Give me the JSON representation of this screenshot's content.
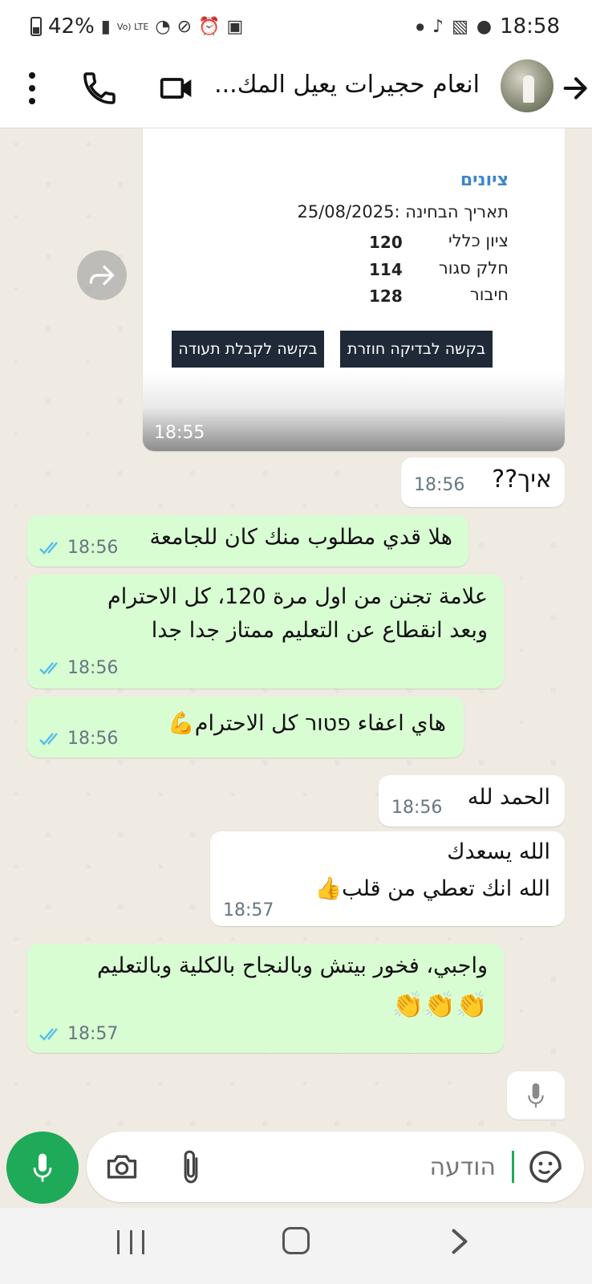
{
  "status_bar": {
    "battery": "42%",
    "time": "18:58",
    "volte_label": "Vo) LTE"
  },
  "header": {
    "contact_name": "انعام حجيرات يعيل المك...",
    "icons": [
      "back-arrow-icon",
      "avatar",
      "video-call-icon",
      "voice-call-icon",
      "more-options-icon"
    ]
  },
  "image_card": {
    "section_title": "ציונים",
    "exam_date": "תאריך הבחינה :25/08/2025",
    "rows": [
      {
        "label": "ציון כללי",
        "value": "120"
      },
      {
        "label": "חלק סגור",
        "value": "114"
      },
      {
        "label": "חיבור",
        "value": "128"
      }
    ],
    "button_recheck": "בקשה לבדיקה חוזרת",
    "button_certificate": "בקשה לקבלת תעודה",
    "time": "18:55"
  },
  "messages": [
    {
      "dir": "in",
      "lines": [
        "איך??"
      ],
      "time": "18:56"
    },
    {
      "dir": "out",
      "lines": [
        "هلا قدي مطلوب منك كان للجامعة"
      ],
      "time": "18:56"
    },
    {
      "dir": "out",
      "lines": [
        "علامة تجنن من اول مرة 120، كل الاحترام",
        "وبعد انقطاع عن التعليم ممتاز جدا جدا"
      ],
      "time": "18:56"
    },
    {
      "dir": "out",
      "lines": [
        "هاي اعفاء פטור كل الاحترام💪"
      ],
      "time": "18:56"
    },
    {
      "dir": "in",
      "lines": [
        "الحمد لله"
      ],
      "time": "18:56"
    },
    {
      "dir": "in",
      "lines": [
        "الله يسعدك",
        "الله انك تعطي من قلب👍"
      ],
      "time": "18:57"
    },
    {
      "dir": "out",
      "lines": [
        "واجبي، فخور بيتش وبالنجاح بالكلية وبالتعليم",
        "👏👏👏"
      ],
      "time": "18:57"
    }
  ],
  "input": {
    "placeholder": "הודעה"
  },
  "colors": {
    "outgoing_bubble": "#d9fdd3",
    "incoming_bubble": "#ffffff",
    "read_ticks": "#53bdeb",
    "accent_green": "#1faa59",
    "chat_background": "#efeae2"
  }
}
